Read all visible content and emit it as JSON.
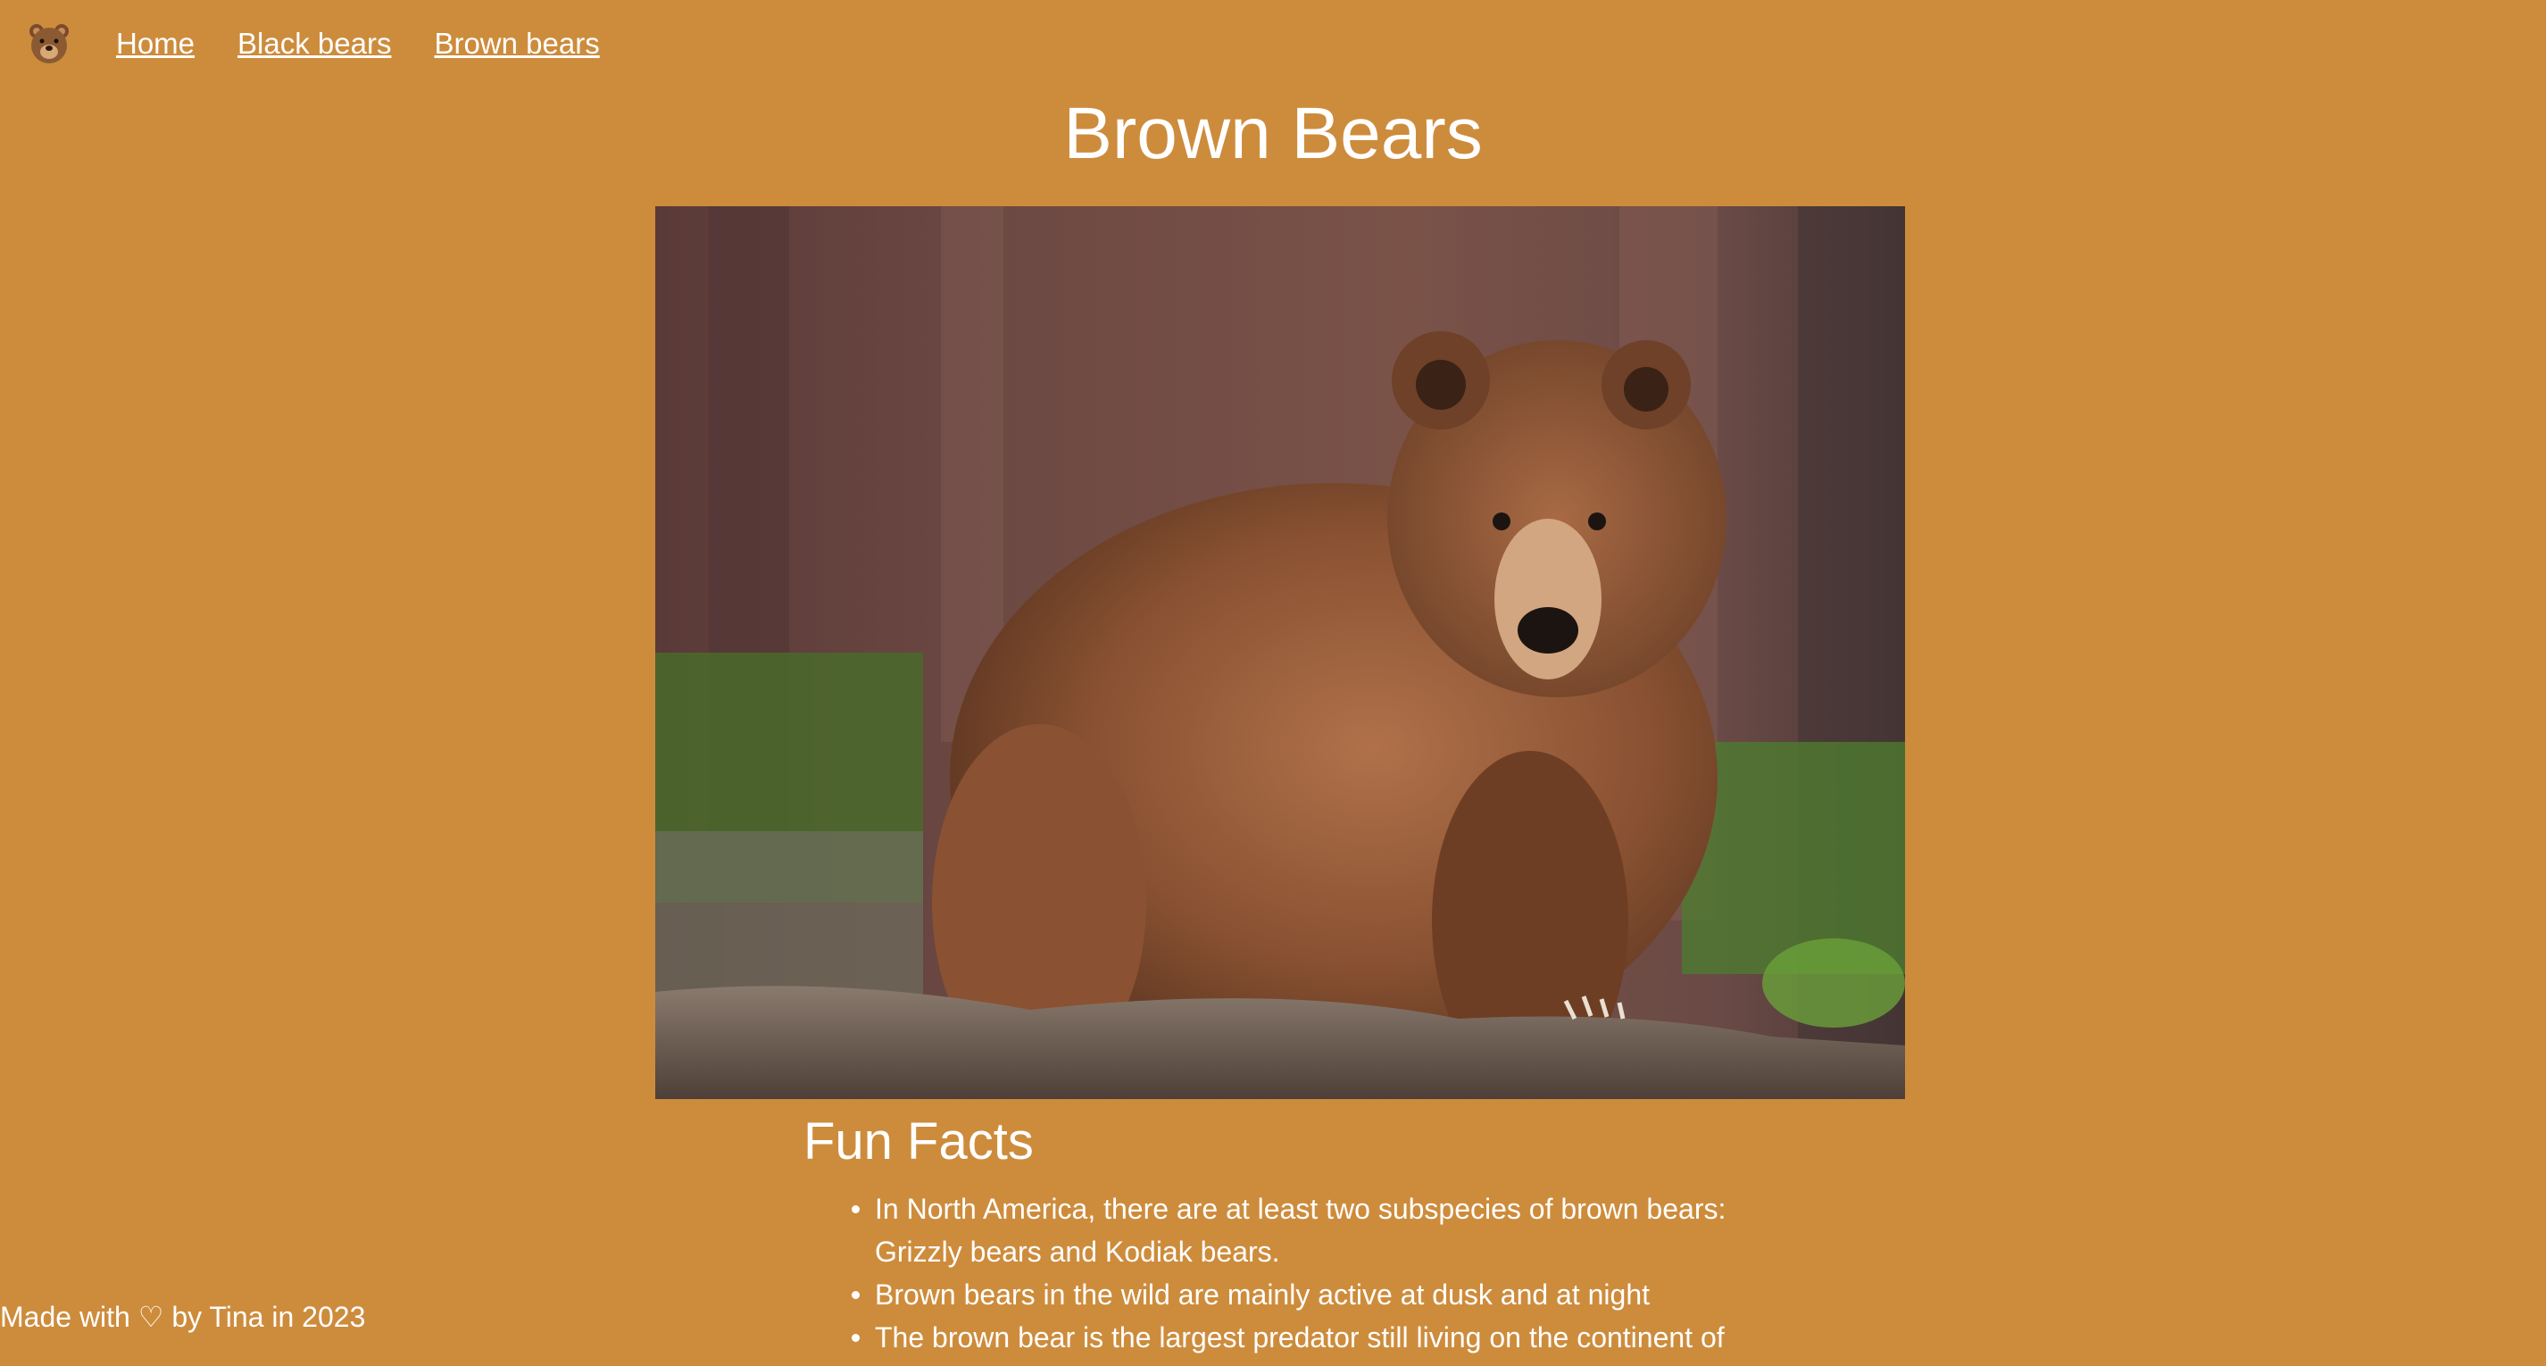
{
  "nav": {
    "logo_icon": "bear-face-icon",
    "links": [
      {
        "label": "Home"
      },
      {
        "label": "Black bears"
      },
      {
        "label": "Brown bears"
      }
    ]
  },
  "main": {
    "title": "Brown Bears",
    "image_subject": "brown-bear-photo",
    "facts_heading": "Fun Facts",
    "facts": [
      "In North America, there are at least two subspecies of brown bears: Grizzly bears and Kodiak bears.",
      "Brown bears in the wild are mainly active at dusk and at night",
      "The brown bear is the largest predator still living on the continent of"
    ]
  },
  "footer": {
    "text": "Made with ♡ by Tina in 2023"
  },
  "colors": {
    "background": "#cd8c3c",
    "text": "#ffffff"
  }
}
